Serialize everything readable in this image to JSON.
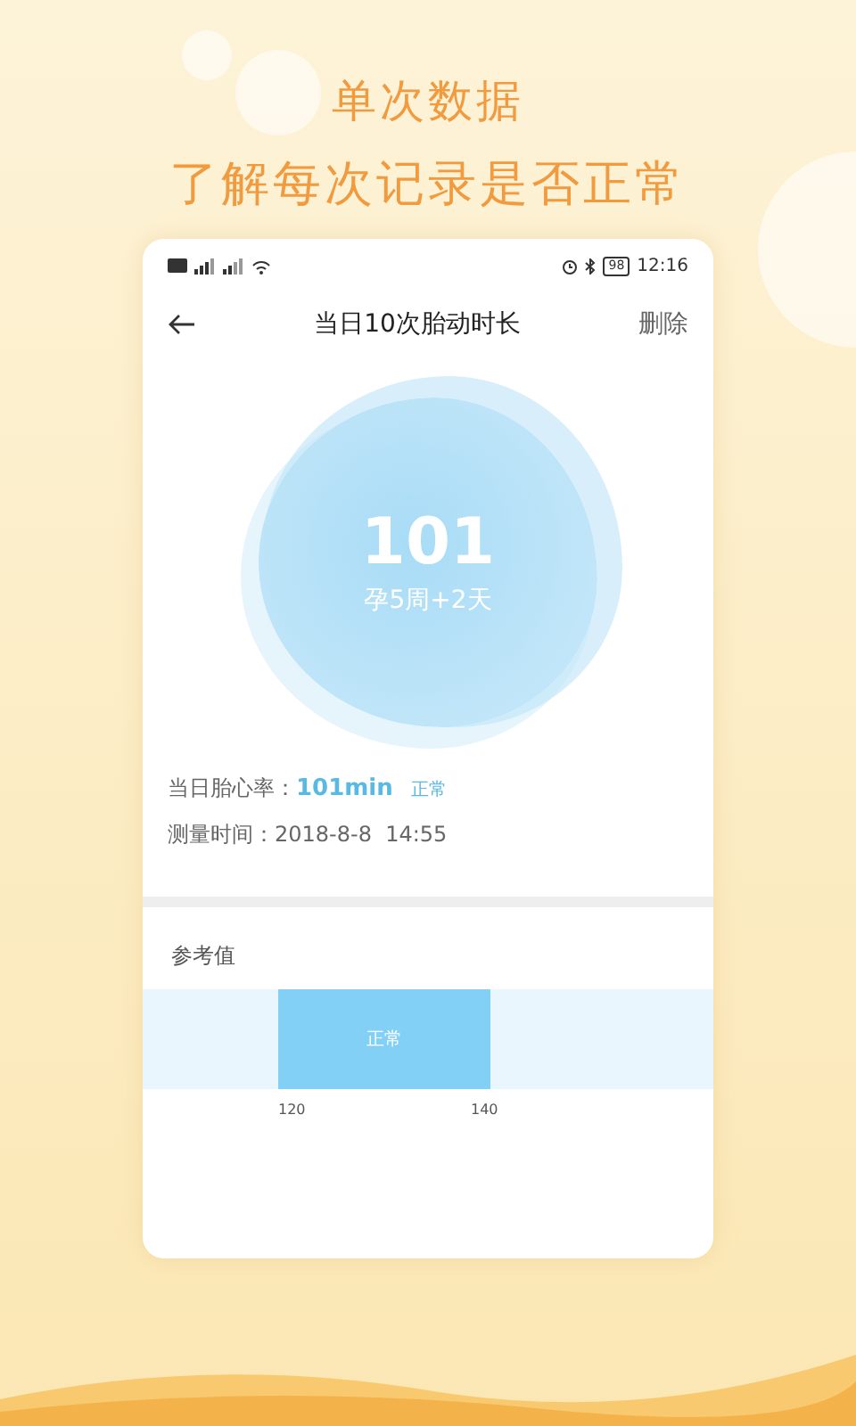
{
  "headline": [
    "单次数据",
    "了解每次记录是否正常"
  ],
  "status_bar": {
    "battery": "98",
    "time": "12:16"
  },
  "header": {
    "title": "当日10次胎动时长",
    "action": "删除"
  },
  "summary": {
    "value": "101",
    "subtitle": "孕5周+2天"
  },
  "details": [
    {
      "kind": "highlight",
      "label": "当日胎心率：",
      "value": "101min",
      "tag": "正常"
    },
    {
      "kind": "plain",
      "label": "测量时间：",
      "value": "2018-8-8  14:55"
    }
  ],
  "reference": {
    "title": "参考值",
    "band_label": "正常",
    "ticks": [
      "120",
      "140"
    ]
  }
}
